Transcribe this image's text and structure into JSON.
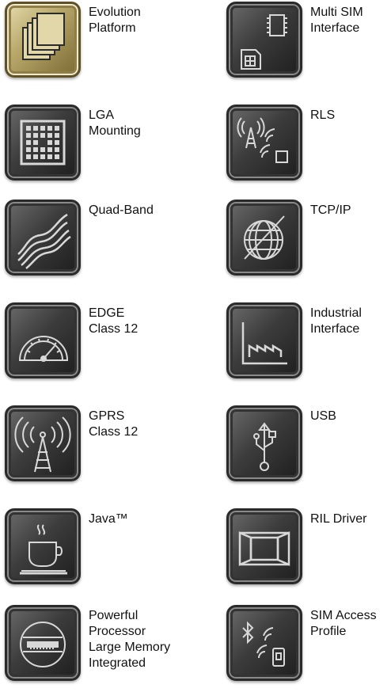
{
  "features": {
    "evolution": {
      "label": "Evolution\nPlatform",
      "icon": "stacked-layers-icon"
    },
    "multi_sim": {
      "label": "Multi SIM\nInterface",
      "icon": "sim-chip-icon"
    },
    "lga": {
      "label": "LGA\nMounting",
      "icon": "lga-grid-icon"
    },
    "rls": {
      "label": "RLS",
      "icon": "rls-signal-icon"
    },
    "quad_band": {
      "label": "Quad-Band",
      "icon": "wave-bands-icon"
    },
    "tcp_ip": {
      "label": "TCP/IP",
      "icon": "globe-icon"
    },
    "edge": {
      "label": "EDGE\nClass 12",
      "icon": "speedometer-icon"
    },
    "industrial": {
      "label": "Industrial\nInterface",
      "icon": "factory-icon"
    },
    "gprs": {
      "label": "GPRS\nClass 12",
      "icon": "antenna-tower-icon"
    },
    "usb": {
      "label": "USB",
      "icon": "usb-icon"
    },
    "java": {
      "label": "Java™",
      "icon": "coffee-cup-icon"
    },
    "ril": {
      "label": "RIL Driver",
      "icon": "window-icon"
    },
    "processor": {
      "label": "Powerful\nProcessor\nLarge Memory\nIntegrated",
      "icon": "processor-chip-icon"
    },
    "sim_access": {
      "label": "SIM Access\nProfile",
      "icon": "bluetooth-sim-icon"
    }
  },
  "colors": {
    "tile": "#3c3c3c",
    "tile_gold": "#b8a86a",
    "glyph": "#d8d8d8",
    "text": "#111111"
  }
}
